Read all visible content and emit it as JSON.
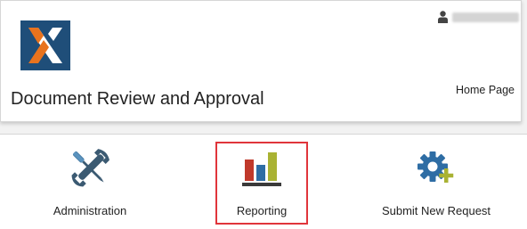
{
  "header": {
    "app_title": "Document Review and Approval",
    "home_link": "Home Page",
    "logo_icon": "x-logo-icon",
    "user_icon": "user-icon",
    "user_name": ""
  },
  "tiles": [
    {
      "label": "Administration",
      "icon": "wrench-screwdriver-icon"
    },
    {
      "label": "Reporting",
      "icon": "bar-chart-icon",
      "selected": true
    },
    {
      "label": "Submit New Request",
      "icon": "gear-plus-icon"
    }
  ],
  "colors": {
    "logo_background": "#1f4e79",
    "logo_orange": "#e8731e",
    "selection_border": "#e0353b",
    "bar_red": "#c0392b",
    "bar_blue": "#2e6da4",
    "bar_olive": "#a9b233",
    "gear_blue": "#2e6da4",
    "plus_olive": "#a9b233"
  }
}
